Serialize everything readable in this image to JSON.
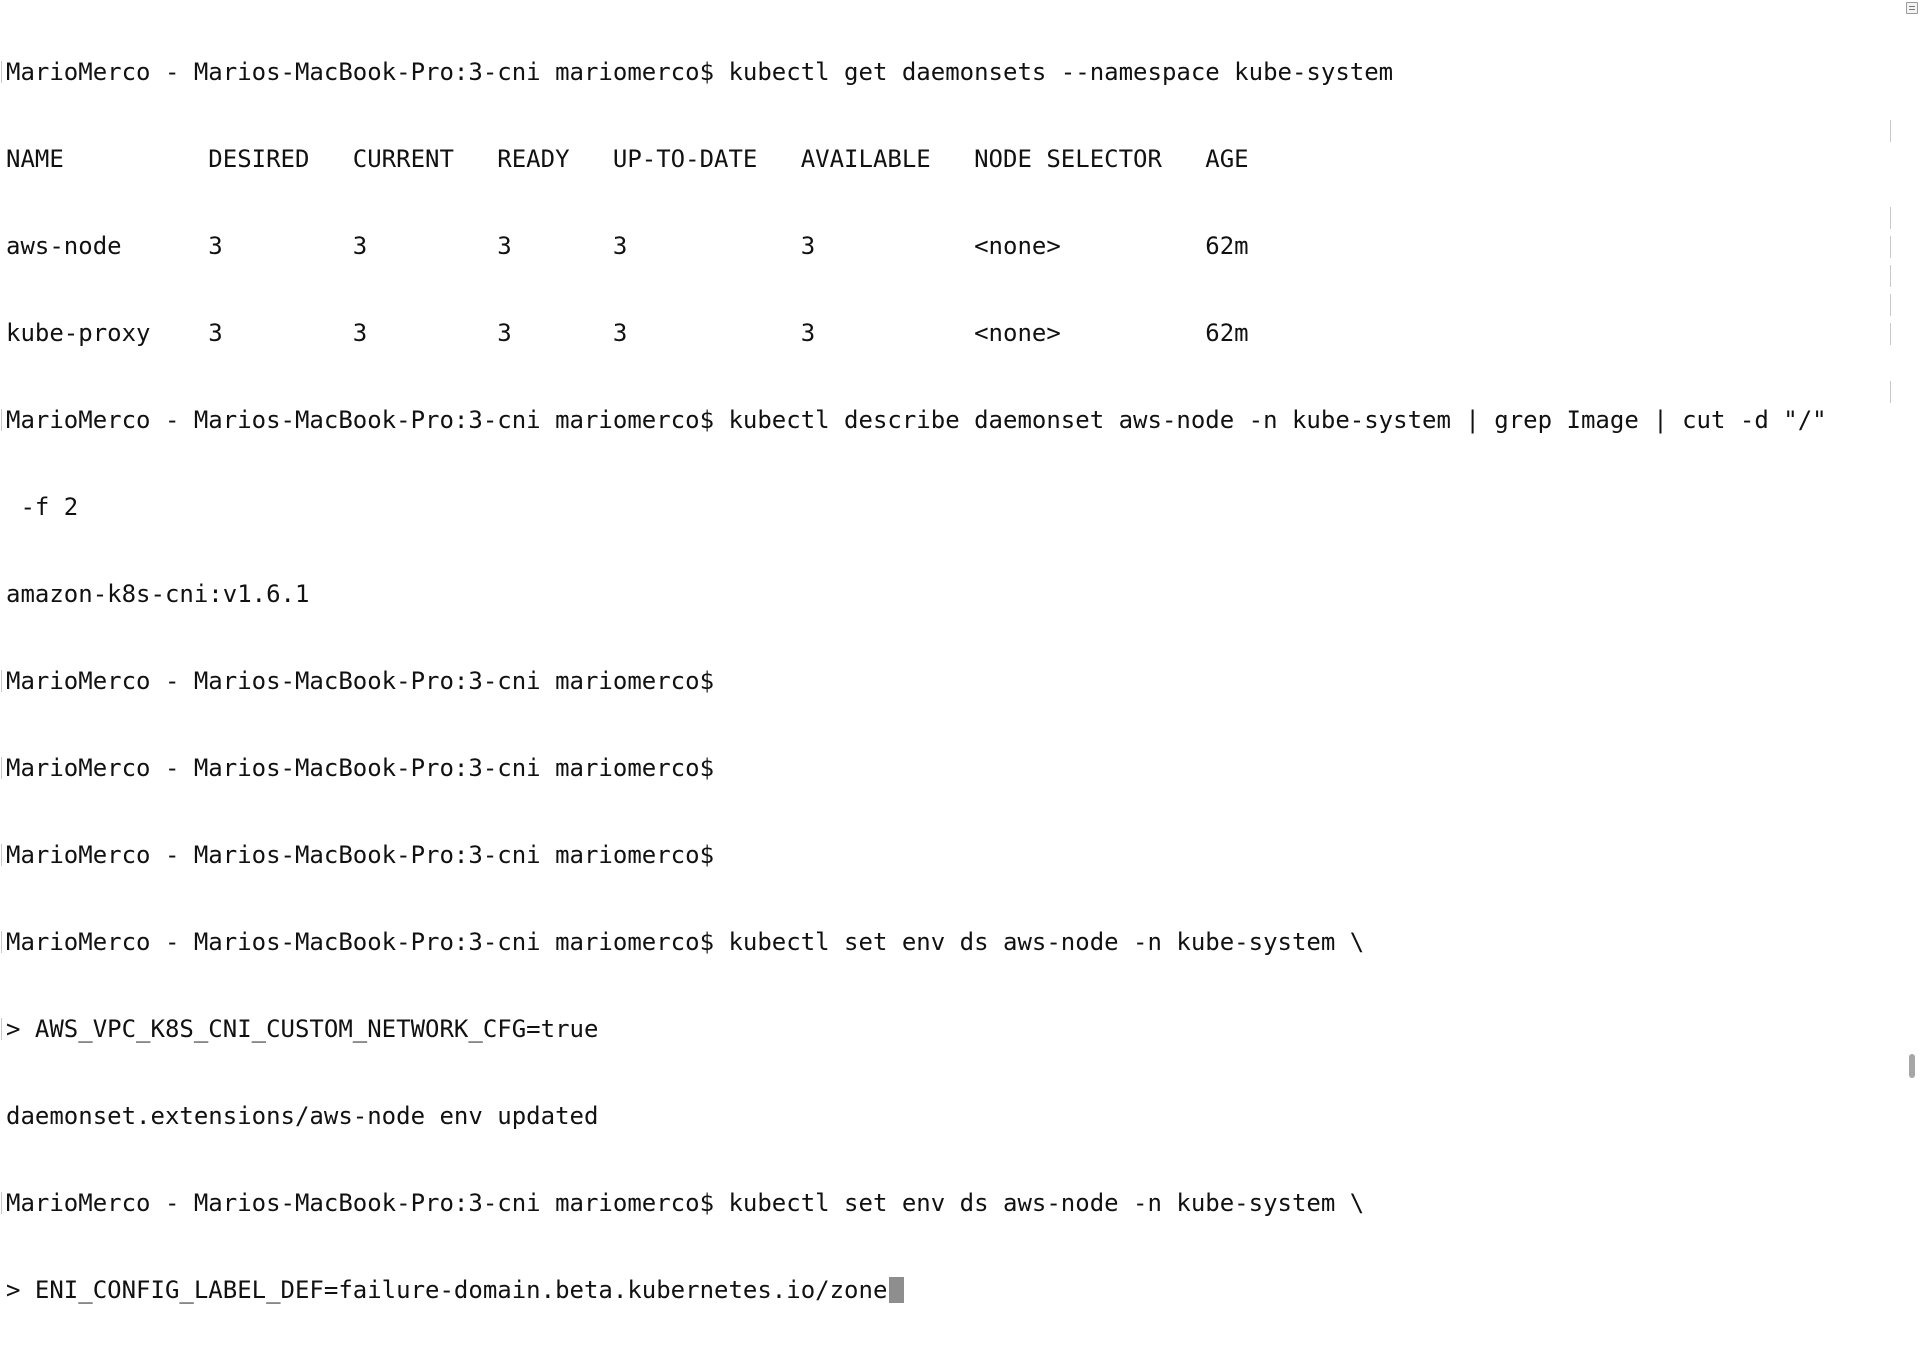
{
  "terminal": {
    "lines": [
      "MarioMerco - Marios-MacBook-Pro:3-cni mariomerco$ kubectl get daemonsets --namespace kube-system",
      "NAME          DESIRED   CURRENT   READY   UP-TO-DATE   AVAILABLE   NODE SELECTOR   AGE",
      "aws-node      3         3         3       3            3           <none>          62m",
      "kube-proxy    3         3         3       3            3           <none>          62m",
      "MarioMerco - Marios-MacBook-Pro:3-cni mariomerco$ kubectl describe daemonset aws-node -n kube-system | grep Image | cut -d \"/\"",
      " -f 2",
      "amazon-k8s-cni:v1.6.1",
      "MarioMerco - Marios-MacBook-Pro:3-cni mariomerco$",
      "MarioMerco - Marios-MacBook-Pro:3-cni mariomerco$",
      "MarioMerco - Marios-MacBook-Pro:3-cni mariomerco$",
      "MarioMerco - Marios-MacBook-Pro:3-cni mariomerco$ kubectl set env ds aws-node -n kube-system \\",
      "> AWS_VPC_K8S_CNI_CUSTOM_NETWORK_CFG=true",
      "daemonset.extensions/aws-node env updated",
      "MarioMerco - Marios-MacBook-Pro:3-cni mariomerco$ kubectl set env ds aws-node -n kube-system \\",
      "> ENI_CONFIG_LABEL_DEF=failure-domain.beta.kubernetes.io/zone"
    ]
  },
  "colors": {
    "background": "#ffffff",
    "text": "#111111",
    "cursor": "#8e8e8e"
  }
}
